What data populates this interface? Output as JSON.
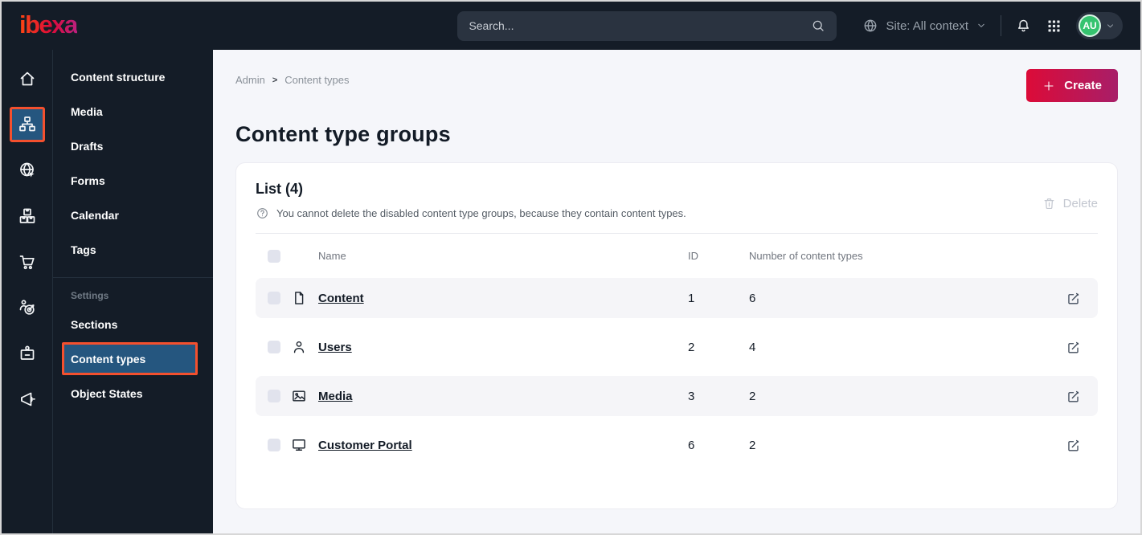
{
  "topbar": {
    "logo": "ibexa",
    "search_placeholder": "Search...",
    "site_context": "Site: All context",
    "avatar_initials": "AU"
  },
  "rail": {
    "items": [
      {
        "icon": "home",
        "active": false
      },
      {
        "icon": "content-structure",
        "active": true
      },
      {
        "icon": "site",
        "active": false
      },
      {
        "icon": "products",
        "active": false
      },
      {
        "icon": "commerce",
        "active": false
      },
      {
        "icon": "personalization",
        "active": false
      },
      {
        "icon": "admin",
        "active": false
      },
      {
        "icon": "marketing",
        "active": false
      }
    ]
  },
  "sidebar": {
    "items": [
      {
        "label": "Content structure"
      },
      {
        "label": "Media"
      },
      {
        "label": "Drafts"
      },
      {
        "label": "Forms"
      },
      {
        "label": "Calendar"
      },
      {
        "label": "Tags"
      }
    ],
    "settings_label": "Settings",
    "settings_items": [
      {
        "label": "Sections"
      },
      {
        "label": "Content types",
        "active": true
      },
      {
        "label": "Object States"
      }
    ]
  },
  "main": {
    "breadcrumb": {
      "items": [
        "Admin",
        "Content types"
      ],
      "separator": ">"
    },
    "create_label": "Create",
    "title": "Content type groups"
  },
  "list_card": {
    "title": "List (4)",
    "info": "You cannot delete the disabled content type groups, because they contain content types.",
    "delete_label": "Delete",
    "table": {
      "columns": [
        "Name",
        "ID",
        "Number of content types"
      ],
      "rows": [
        {
          "icon": "file",
          "name": "Content",
          "id": "1",
          "count": "6"
        },
        {
          "icon": "user",
          "name": "Users",
          "id": "2",
          "count": "4"
        },
        {
          "icon": "image",
          "name": "Media",
          "id": "3",
          "count": "2"
        },
        {
          "icon": "monitor",
          "name": "Customer Portal",
          "id": "6",
          "count": "2"
        }
      ]
    }
  },
  "colors": {
    "topbar_bg": "#141c27",
    "active_item_blue": "#25567f",
    "highlight_orange": "#f4502e",
    "create_gradient_start": "#dc0b38",
    "create_gradient_end": "#a81e68",
    "avatar_green": "#35c36f",
    "logo_gradient_start": "#ff4713",
    "logo_gradient_end": "#bb2180"
  }
}
